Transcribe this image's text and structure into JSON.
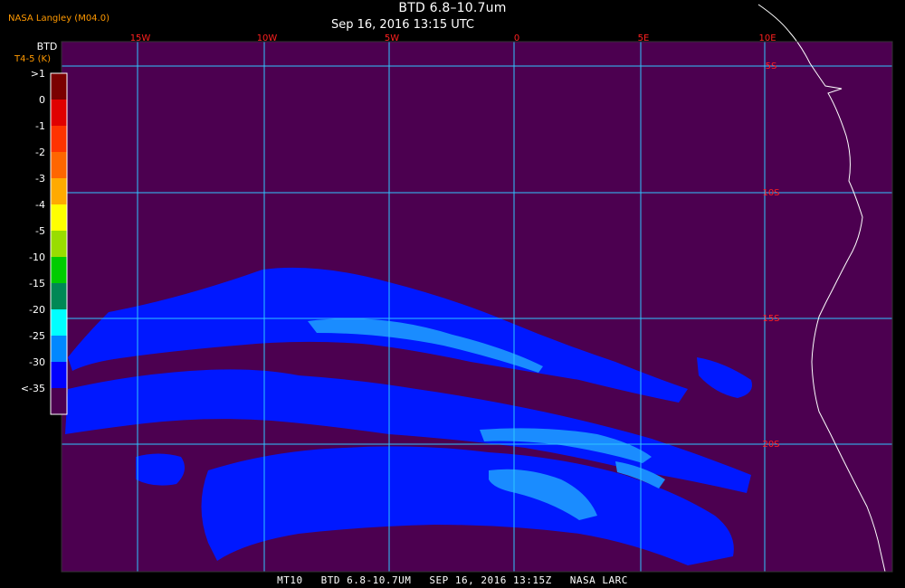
{
  "header": {
    "agency": "NASA Langley (M04.0)",
    "title": "BTD 6.8–10.7um",
    "subtitle": "Sep 16, 2016 13:15 UTC"
  },
  "legend": {
    "title": "BTD",
    "subtitle": "T4-5 (K)",
    "entries": [
      {
        "label": ">1",
        "color": "#7a0000"
      },
      {
        "label": "0",
        "color": "#e00000"
      },
      {
        "label": "-1",
        "color": "#ff3300"
      },
      {
        "label": "-2",
        "color": "#ff6600"
      },
      {
        "label": "-3",
        "color": "#ffaa00"
      },
      {
        "label": "-4",
        "color": "#ffff00"
      },
      {
        "label": "-5",
        "color": "#99dd00"
      },
      {
        "label": "-10",
        "color": "#00cc00"
      },
      {
        "label": "-15",
        "color": "#008855"
      },
      {
        "label": "-20",
        "color": "#00ffff"
      },
      {
        "label": "-25",
        "color": "#0088ff"
      },
      {
        "label": "-30",
        "color": "#0000ff"
      },
      {
        "label": "<-35",
        "color": "#4c0050"
      }
    ]
  },
  "map": {
    "background_color": "#4c0050",
    "grid_color": "#2fc6ff",
    "label_color": "#ff2020",
    "coast_color": "#ffffff",
    "lon_labels": [
      "15W",
      "10W",
      "5W",
      "0",
      "5E",
      "10E"
    ],
    "lat_labels": [
      "5S",
      "10S",
      "15S",
      "20S"
    ]
  },
  "footer": {
    "satellite": "MT10",
    "product": "BTD 6.8-10.7UM",
    "datetime": "SEP 16, 2016 13:15Z",
    "source": "NASA LARC"
  },
  "colors": {
    "cloud_dark_blue": "#0018ff",
    "cloud_light_blue": "#1a8cff"
  }
}
